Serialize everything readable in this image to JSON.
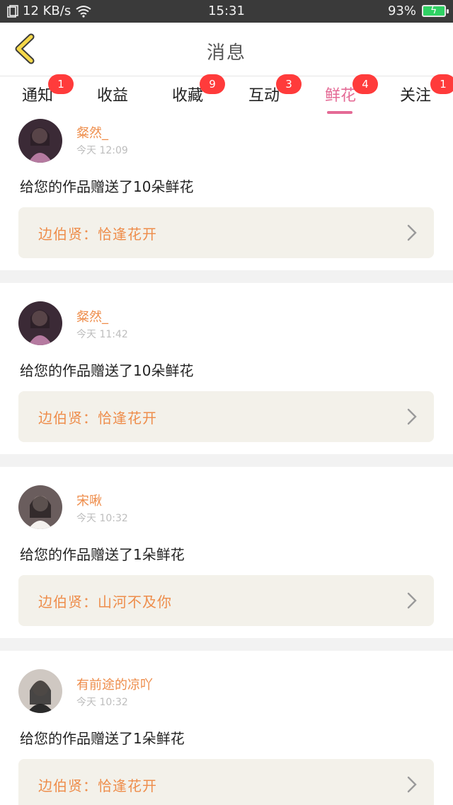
{
  "status_bar": {
    "net_speed": "12 KB/s",
    "time": "15:31",
    "battery": "93%",
    "colors": {
      "background": "#3a3a3a",
      "battery_fill": "#2fd163"
    }
  },
  "header": {
    "title": "消息",
    "back_icon": "back-chevron-icon"
  },
  "tabs": [
    {
      "label": "通知",
      "badge": "1"
    },
    {
      "label": "收益",
      "badge": ""
    },
    {
      "label": "收藏",
      "badge": "9"
    },
    {
      "label": "互动",
      "badge": "3"
    },
    {
      "label": "鲜花",
      "badge": "4"
    },
    {
      "label": "关注",
      "badge": "1"
    }
  ],
  "active_tab": "鲜花",
  "feed": [
    {
      "user": "粲然_",
      "time": "今天 12:09",
      "message": "给您的作品赠送了10朵鲜花",
      "work": "边伯贤：恰逢花开"
    },
    {
      "user": "粲然_",
      "time": "今天 11:42",
      "message": "给您的作品赠送了10朵鲜花",
      "work": "边伯贤：恰逢花开"
    },
    {
      "user": "宋啾",
      "time": "今天 10:32",
      "message": "给您的作品赠送了1朵鲜花",
      "work": "边伯贤：山河不及你"
    },
    {
      "user": "有前途的凉吖",
      "time": "今天 10:32",
      "message": "给您的作品赠送了1朵鲜花",
      "work": "边伯贤：恰逢花开"
    }
  ],
  "colors": {
    "accent_pink": "#e46a95",
    "name_orange": "#ee8d4b",
    "badge_red": "#ff3b3b",
    "card_bg": "#f3f1ea"
  }
}
